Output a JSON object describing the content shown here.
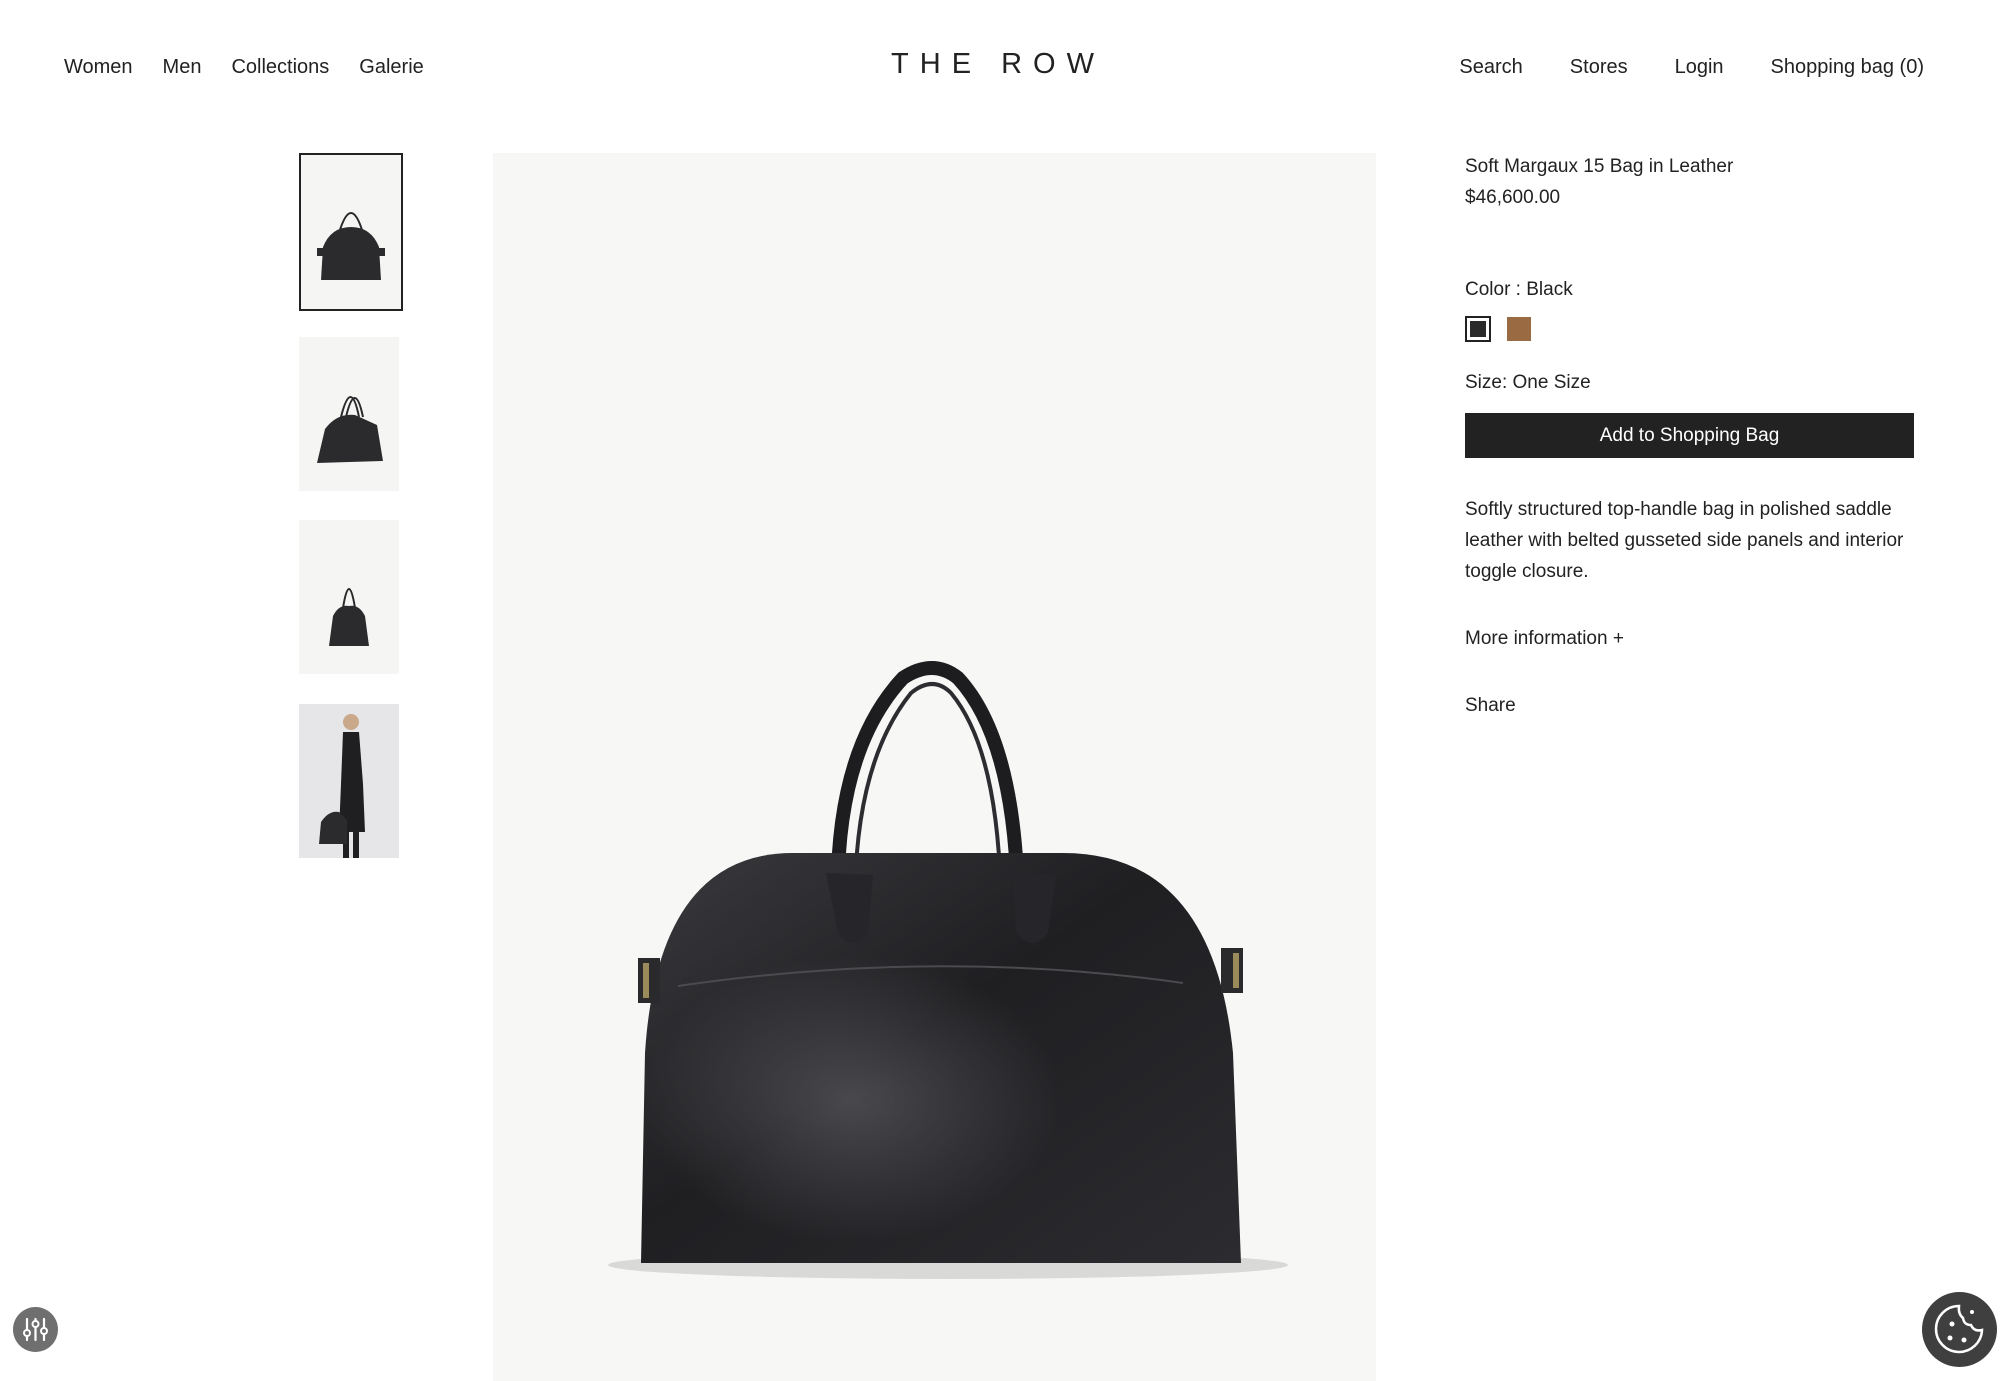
{
  "header": {
    "nav_left": [
      "Women",
      "Men",
      "Collections",
      "Galerie"
    ],
    "logo": "THE ROW",
    "nav_right": {
      "search": "Search",
      "stores": "Stores",
      "login": "Login",
      "bag": "Shopping bag (0)"
    }
  },
  "product": {
    "title": "Soft Margaux 15 Bag in Leather",
    "price": "$46,600.00",
    "color_label": "Color : Black",
    "color_options": [
      {
        "name": "Black",
        "hex": "#2b2b2b",
        "selected": true
      },
      {
        "name": "Brown",
        "hex": "#9a6a43",
        "selected": false
      }
    ],
    "size_label": "Size: One Size",
    "add_button": "Add to Shopping Bag",
    "description": "Softly structured top-handle bag in polished saddle leather with belted gusseted side panels and interior toggle closure.",
    "more_info": "More information  +",
    "share": "Share"
  },
  "gallery": {
    "thumbnails": [
      "bag-front",
      "bag-angle",
      "bag-side",
      "model-with-bag"
    ],
    "selected_index": 0,
    "hero": "bag-front"
  },
  "icons": {
    "filter": "sliders-icon",
    "cookie": "cookie-icon"
  }
}
